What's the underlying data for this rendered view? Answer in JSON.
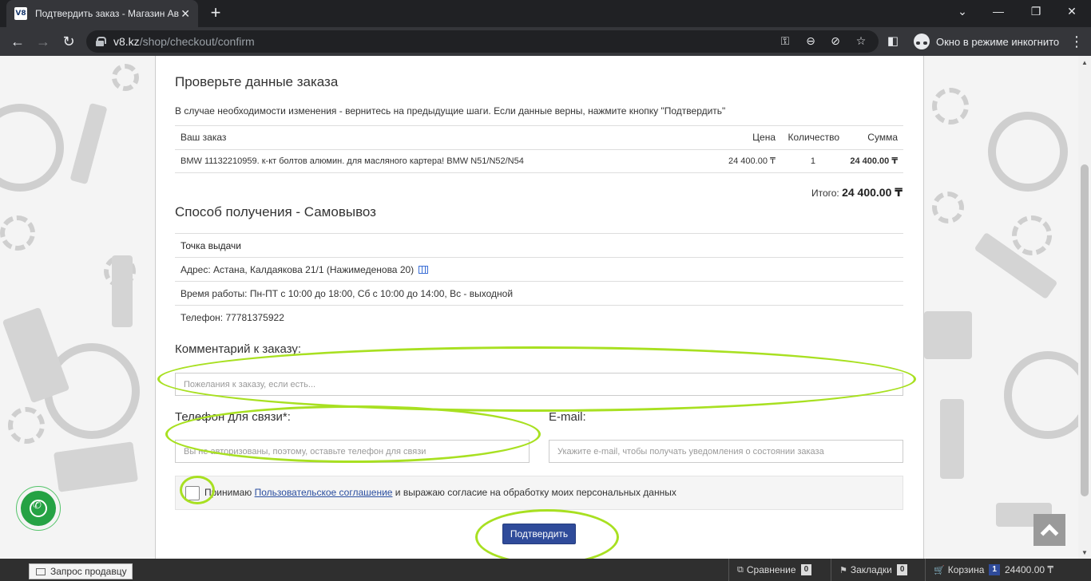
{
  "browser": {
    "tab_title": "Подтвердить заказ - Магазин Ав",
    "favicon_text": "V8",
    "url_host": "v8.kz",
    "url_path": "/shop/checkout/confirm",
    "incognito_label": "Окно в режиме инкогнито"
  },
  "page": {
    "check_title": "Проверьте данные заказа",
    "check_note": "В случае необходимости изменения - вернитесь на предыдущие шаги. Если данные верны, нажмите кнопку \"Подтвердить\"",
    "order_table": {
      "headers": {
        "item": "Ваш заказ",
        "price": "Цена",
        "qty": "Количество",
        "sum": "Сумма"
      },
      "rows": [
        {
          "item": "BMW 11132210959. к-кт болтов алюмин. для масляного картера! BMW N51/N52/N54",
          "price": "24 400.00 ₸",
          "qty": "1",
          "sum": "24 400.00 ₸"
        }
      ]
    },
    "total_label": "Итого:",
    "total_value": "24 400.00 ₸",
    "delivery_title": "Способ получения - Самовывоз",
    "pickup": {
      "head": "Точка выдачи",
      "address": "Адрес: Астана, Калдаякова 21/1 (Нажимеденова 20)",
      "hours": "Время работы: Пн-ПТ с 10:00 до 18:00, Сб с 10:00 до 14:00, Вс - выходной",
      "phone": "Телефон: 77781375922"
    },
    "comment_label": "Комментарий к заказу:",
    "comment_placeholder": "Пожелания к заказу, если есть...",
    "phone_label": "Телефон для связи*:",
    "phone_placeholder": "Вы не авторизованы, поэтому, оставьте телефон для связи",
    "email_label": "E-mail:",
    "email_placeholder": "Укажите e-mail, чтобы получать уведомления о состоянии заказа",
    "agree_prefix": "Принимаю",
    "agree_link": "Пользовательское соглашение",
    "agree_suffix": "и выражаю согласие на обработку моих персональных данных",
    "confirm_label": "Подтвердить"
  },
  "bottom_bar": {
    "seller_request": "Запрос продавцу",
    "compare_label": "Сравнение",
    "compare_count": "0",
    "bookmarks_label": "Закладки",
    "bookmarks_count": "0",
    "cart_label": "Корзина",
    "cart_count": "1",
    "cart_sum": "24400.00 ₸"
  },
  "colors": {
    "highlight": "#a8e021",
    "confirm_button": "#2f4b9a",
    "whatsapp": "#25a244"
  }
}
